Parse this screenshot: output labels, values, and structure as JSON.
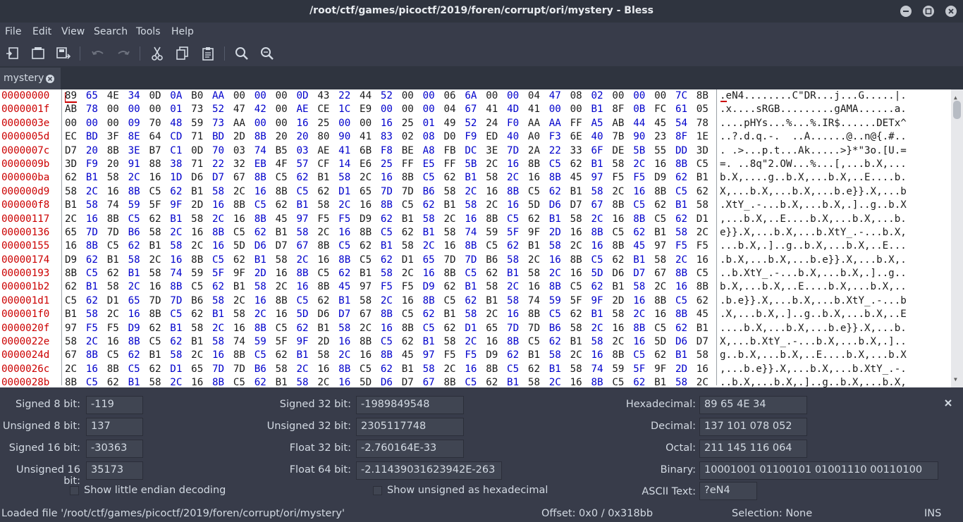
{
  "window": {
    "title": "/root/ctf/games/picoctf/2019/foren/corrupt/ori/mystery - Bless",
    "controls": [
      "minimize-icon",
      "maximize-icon",
      "close-icon"
    ]
  },
  "menu": [
    "File",
    "Edit",
    "View",
    "Search",
    "Tools",
    "Help"
  ],
  "toolbar": {
    "buttons": [
      "new-file-icon",
      "open-file-icon",
      "save-file-icon",
      "undo-icon",
      "redo-icon",
      "cut-icon",
      "copy-icon",
      "paste-icon",
      "find-icon",
      "find-replace-icon"
    ],
    "disabled": [
      "undo-icon",
      "redo-icon"
    ]
  },
  "tab": {
    "label": "mystery"
  },
  "hex": {
    "offsets": [
      "00000000",
      "0000001f",
      "0000003e",
      "0000005d",
      "0000007c",
      "0000009b",
      "000000ba",
      "000000d9",
      "000000f8",
      "00000117",
      "00000136",
      "00000155",
      "00000174",
      "00000193",
      "000001b2",
      "000001d1",
      "000001f0",
      "0000020f",
      "0000022e",
      "0000024d",
      "0000026c",
      "0000028b"
    ],
    "rows": [
      "89 65 4E 34 0D 0A B0 AA 00 00 00 0D 43 22 44 52 00 00 06 6A 00 00 04 47 08 02 00 00 00 7C 8B",
      "AB 78 00 00 00 01 73 52 47 42 00 AE CE 1C E9 00 00 00 04 67 41 4D 41 00 00 B1 8F 0B FC 61 05",
      "00 00 00 09 70 48 59 73 AA 00 00 16 25 00 00 16 25 01 49 52 24 F0 AA AA FF A5 AB 44 45 54 78 5E",
      "EC BD 3F 8E 64 CD 71 BD 2D 8B 20 20 80 90 41 83 02 08 D0 F9 ED 40 A0 F3 6E 40 7B 90 23 8F 1E",
      "D7 20 8B 3E B7 C1 0D 70 03 74 B5 03 AE 41 6B F8 BE A8 FB DC 3E 7D 2A 22 33 6F DE 5B 55 DD 3D",
      "3D F9 20 91 88 38 71 22 32 EB 4F 57 CF 14 E6 25 FF E5 FF 5B 2C 16 8B C5 62 B1 58 2C 16 8B C5",
      "62 B1 58 2C 16 1D D6 D7 67 8B C5 62 B1 58 2C 16 8B C5 62 B1 58 2C 16 8B 45 97 F5 F5 D9 62 B1",
      "58 2C 16 8B C5 62 B1 58 2C 16 8B C5 62 D1 65 7D 7D B6 58 2C 16 8B C5 62 B1 58 2C 16 8B C5 62",
      "B1 58 74 59 5F 9F 2D 16 8B C5 62 B1 58 2C 16 8B C5 62 B1 58 2C 16 5D D6 D7 67 8B C5 62 B1 58",
      "2C 16 8B C5 62 B1 58 2C 16 8B 45 97 F5 F5 D9 62 B1 58 2C 16 8B C5 62 B1 58 2C 16 8B C5 62 D1",
      "65 7D 7D B6 58 2C 16 8B C5 62 B1 58 2C 16 8B C5 62 B1 58 74 59 5F 9F 2D 16 8B C5 62 B1 58 2C",
      "16 8B C5 62 B1 58 2C 16 5D D6 D7 67 8B C5 62 B1 58 2C 16 8B C5 62 B1 58 2C 16 8B 45 97 F5 F5",
      "D9 62 B1 58 2C 16 8B C5 62 B1 58 2C 16 8B C5 62 D1 65 7D 7D B6 58 2C 16 8B C5 62 B1 58 2C 16",
      "8B C5 62 B1 58 74 59 5F 9F 2D 16 8B C5 62 B1 58 2C 16 8B C5 62 B1 58 2C 16 5D D6 D7 67 8B C5",
      "62 B1 58 2C 16 8B C5 62 B1 58 2C 16 8B 45 97 F5 F5 D9 62 B1 58 2C 16 8B C5 62 B1 58 2C 16 8B",
      "C5 62 D1 65 7D 7D B6 58 2C 16 8B C5 62 B1 58 2C 16 8B C5 62 B1 58 74 59 5F 9F 2D 16 8B C5 62",
      "B1 58 2C 16 8B C5 62 B1 58 2C 16 5D D6 D7 67 8B C5 62 B1 58 2C 16 8B C5 62 B1 58 2C 16 8B 45",
      "97 F5 F5 D9 62 B1 58 2C 16 8B C5 62 B1 58 2C 16 8B C5 62 D1 65 7D 7D B6 58 2C 16 8B C5 62 B1",
      "58 2C 16 8B C5 62 B1 58 74 59 5F 9F 2D 16 8B C5 62 B1 58 2C 16 8B C5 62 B1 58 2C 16 5D D6 D7",
      "67 8B C5 62 B1 58 2C 16 8B C5 62 B1 58 2C 16 8B 45 97 F5 F5 D9 62 B1 58 2C 16 8B C5 62 B1 58",
      "2C 16 8B C5 62 D1 65 7D 7D B6 58 2C 16 8B C5 62 B1 58 2C 16 8B C5 62 B1 58 74 59 5F 9F 2D 16",
      "8B C5 62 B1 58 2C 16 8B C5 62 B1 58 2C 16 5D D6 D7 67 8B C5 62 B1 58 2C 16 8B C5 62 B1 58 2C"
    ],
    "ascii": [
      ".eN4........C\"DR...j...G.....|.",
      ".x....sRGB.........gAMA......a.",
      "....pHYs...%...%.IR$......DETx^",
      "..?.d.q.-.  ..A......@..n@{.#..",
      ". .>...p.t...Ak.....>}*\"3o.[U.=",
      "=. ..8q\"2.OW...%...[,...b.X,...",
      "b.X,....g..b.X,...b.X,..E....b.",
      "X,...b.X,...b.X,...b.e}}.X,...b.X,...b",
      ".XtY_.-...b.X,...b.X,.]..g..b.X",
      ",...b.X,..E....b.X,...b.X,...b.",
      "e}}.X,...b.X,...b.XtY_.-...b.X,",
      "...b.X,.]..g..b.X,...b.X,..E...",
      ".b.X,...b.X,...b.e}}.X,...b.X,.",
      "..b.XtY_.-...b.X,...b.X,.]..g..",
      "b.X,...b.X,..E....b.X,...b.X,..",
      ".b.e}}.X,...b.X,...b.XtY_.-...b",
      ".X,...b.X,.]..g..b.X,...b.X,..E",
      "....b.X,...b.X,...b.e}}.X,...b.",
      "X,...b.XtY_.-...b.X,...b.X,.]..",
      "g..b.X,...b.X,..E....b.X,...b.X",
      ",...b.e}}.X,...b.X,...b.XtY_.-.",
      "..b.X,...b.X,.]..g..b.X,...b.X,"
    ]
  },
  "conversion": {
    "signed8": {
      "label": "Signed 8 bit:",
      "value": "-119"
    },
    "unsigned8": {
      "label": "Unsigned 8 bit:",
      "value": "137"
    },
    "signed16": {
      "label": "Signed 16 bit:",
      "value": "-30363"
    },
    "unsigned16": {
      "label": "Unsigned 16 bit:",
      "value": "35173"
    },
    "signed32": {
      "label": "Signed 32 bit:",
      "value": "-1989849548"
    },
    "unsigned32": {
      "label": "Unsigned 32 bit:",
      "value": "2305117748"
    },
    "float32": {
      "label": "Float 32 bit:",
      "value": "-2.760164E-33"
    },
    "float64": {
      "label": "Float 64 bit:",
      "value": "-2.11439031623942E-263"
    },
    "hexadecimal": {
      "label": "Hexadecimal:",
      "value": "89 65 4E 34"
    },
    "decimal": {
      "label": "Decimal:",
      "value": "137 101 078 052"
    },
    "octal": {
      "label": "Octal:",
      "value": "211 145 116 064"
    },
    "binary": {
      "label": "Binary:",
      "value": "10001001 01100101 01001110 00110100"
    },
    "ascii": {
      "label": "ASCII Text:",
      "value": "?eN4"
    },
    "little_endian": {
      "label": "Show little endian decoding",
      "checked": false
    },
    "unsigned_hex": {
      "label": "Show unsigned as hexadecimal",
      "checked": false
    }
  },
  "status": {
    "message": "Loaded file '/root/ctf/games/picoctf/2019/foren/corrupt/ori/mystery'",
    "offset": "Offset: 0x0 / 0x318bb",
    "selection": "Selection: None",
    "mode": "INS"
  },
  "colors": {
    "window_bg": "#383c4a",
    "titlebar_bg": "#2f343f",
    "offset_red": "#cc0000",
    "hex_blue": "#0000cc",
    "hex_text": "#1a1a1a"
  }
}
